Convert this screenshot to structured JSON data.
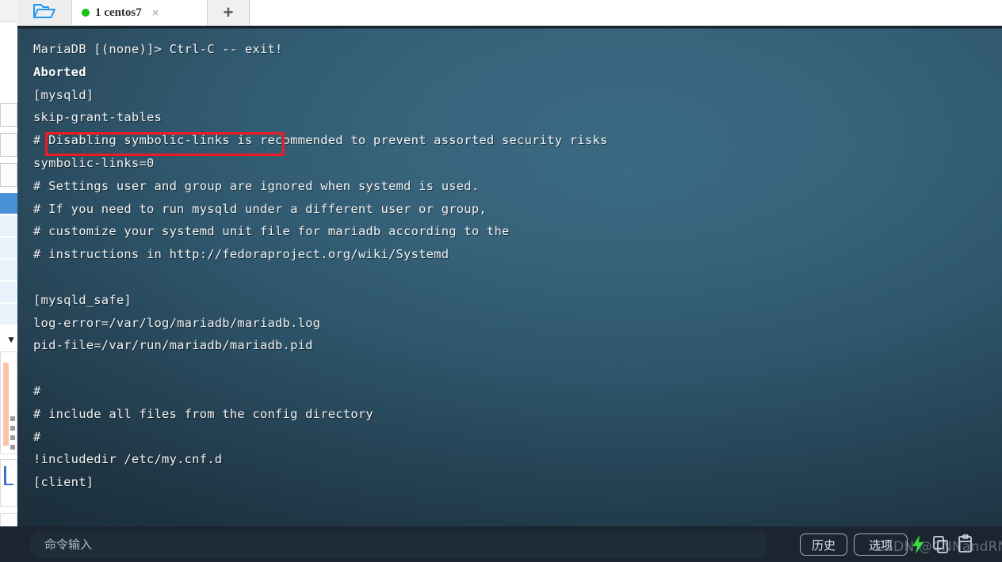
{
  "window": {
    "tabbar": {
      "open_folder_button": "open-folder",
      "new_tab_button": "+",
      "tabs": [
        {
          "status": "connected",
          "label": "1 centos7",
          "close": "×"
        }
      ]
    }
  },
  "terminal": {
    "lines": [
      {
        "text": "MariaDB [(none)]> Ctrl-C -- exit!",
        "bold": false
      },
      {
        "text": "Aborted",
        "bold": true
      },
      {
        "text": "[mysqld]",
        "bold": false
      },
      {
        "text": "skip-grant-tables",
        "bold": false
      },
      {
        "text": "# Disabling symbolic-links is recommended to prevent assorted security risks",
        "bold": false
      },
      {
        "text": "symbolic-links=0",
        "bold": false
      },
      {
        "text": "# Settings user and group are ignored when systemd is used.",
        "bold": false
      },
      {
        "text": "# If you need to run mysqld under a different user or group,",
        "bold": false
      },
      {
        "text": "# customize your systemd unit file for mariadb according to the",
        "bold": false
      },
      {
        "text": "# instructions in http://fedoraproject.org/wiki/Systemd",
        "bold": false
      },
      {
        "text": "",
        "bold": false
      },
      {
        "text": "[mysqld_safe]",
        "bold": false
      },
      {
        "text": "log-error=/var/log/mariadb/mariadb.log",
        "bold": false
      },
      {
        "text": "pid-file=/var/run/mariadb/mariadb.pid",
        "bold": false
      },
      {
        "text": "",
        "bold": false
      },
      {
        "text": "#",
        "bold": false
      },
      {
        "text": "# include all files from the config directory",
        "bold": false
      },
      {
        "text": "#",
        "bold": false
      },
      {
        "text": "!includedir /etc/my.cnf.d",
        "bold": false
      },
      {
        "text": "[client]",
        "bold": false
      }
    ],
    "annotation": {
      "target_line": "skip-grant-tables",
      "color": "#ee1c22"
    }
  },
  "bottom_bar": {
    "command_input": {
      "value": "",
      "placeholder": "命令输入"
    },
    "history_button": "历史",
    "options_button": "选项",
    "icons": [
      "bolt-icon",
      "copy-icon",
      "paste-icon"
    ]
  },
  "watermark": "CSDN @CNNandRNN",
  "colors": {
    "terminal_bg_center": "#36647d",
    "terminal_bg_edge": "#1c2f3c",
    "terminal_text": "#f0f2f2",
    "annotation_red": "#ee1c22",
    "tab_status_green": "#18c018",
    "bottom_bar_bg": "#1b2530",
    "bolt_green": "#2fe02f"
  }
}
